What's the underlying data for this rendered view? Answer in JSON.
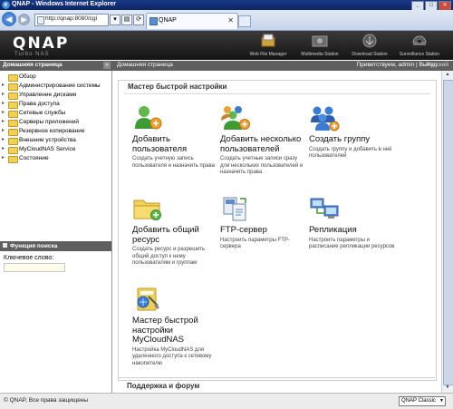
{
  "window": {
    "title": "QNAP - Windows Internet Explorer",
    "address": "http://qnap:8080/cgi",
    "tab_label": "QNAP"
  },
  "header": {
    "logo": "QNAP",
    "tagline": "Turbo NAS",
    "stations": [
      "Web File Manager",
      "Multimedia Station",
      "Download Station",
      "Surveillance Station"
    ]
  },
  "breadcrumb": {
    "home_left": "Домашняя страница",
    "home_main": "Домашняя страница",
    "welcome": "Приветствуем, admin | Выход",
    "language": "Русский"
  },
  "sidebar": {
    "items": [
      {
        "label": "Обзор"
      },
      {
        "label": "Администрирование системы"
      },
      {
        "label": "Управление дисками"
      },
      {
        "label": "Права доступа"
      },
      {
        "label": "Сетевые службы"
      },
      {
        "label": "Серверы приложений"
      },
      {
        "label": "Резервное копирование"
      },
      {
        "label": "Внешние устройства"
      },
      {
        "label": "MyCloudNAS Service"
      },
      {
        "label": "Состояние"
      }
    ],
    "search_title": "Функция поиска",
    "keyword_label": "Ключевое слово:"
  },
  "wizard": {
    "title": "Мастер быстрой настройки",
    "cards": [
      {
        "title": "Добавить пользователя",
        "desc": "Создать учетную запись пользователя и назначить права"
      },
      {
        "title": "Добавить несколько пользователей",
        "desc": "Создать учетные записи сразу для нескольких пользователей и назначить права"
      },
      {
        "title": "Создать группу",
        "desc": "Создать группу и добавить в неё пользователей"
      },
      {
        "title": "Добавить общий ресурс",
        "desc": "Создать ресурс и разрешить общий доступ к нему пользователям и группам"
      },
      {
        "title": "FTP-сервер",
        "desc": "Настроить параметры FTP-сервера"
      },
      {
        "title": "Репликация",
        "desc": "Настроить параметры и расписание репликации ресурсов"
      },
      {
        "title": "Мастер быстрой настройки MyCloudNAS",
        "desc": "Настройка MyCloudNAS для удаленного доступа к сетевому накопителю"
      }
    ]
  },
  "support": {
    "title": "Поддержка и форум"
  },
  "footer": {
    "copyright": "© QNAP, Все права защищены",
    "theme": "QNAP Classic"
  }
}
